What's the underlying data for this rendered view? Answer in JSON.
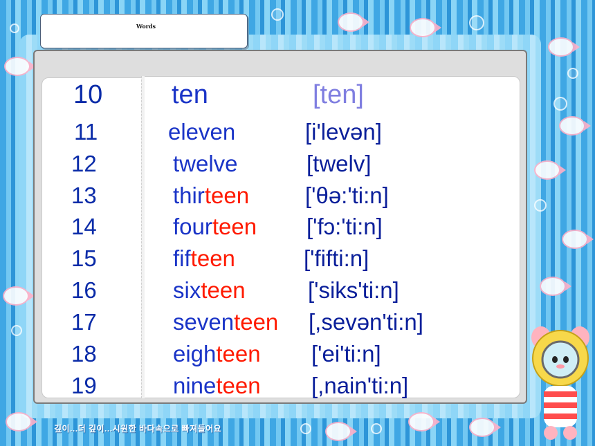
{
  "slide": {
    "title": "Words",
    "caption": "깊이...더 깊이...시원한 바다속으로 빠져들어요",
    "numbers": [
      {
        "number": "10",
        "word_prefix": "",
        "word_stem": "ten",
        "word_suffix": "",
        "phonetic": "[ten]"
      },
      {
        "number": "11",
        "word_prefix": "eleven",
        "word_stem": "",
        "word_suffix": "",
        "phonetic": "[i'levən]"
      },
      {
        "number": "12",
        "word_prefix": "twelve",
        "word_stem": "",
        "word_suffix": "",
        "phonetic": "[twelv]"
      },
      {
        "number": "13",
        "word_prefix": "thir",
        "word_stem": "teen",
        "word_suffix": "",
        "phonetic": "['θə:'ti:n]"
      },
      {
        "number": "14",
        "word_prefix": "four",
        "word_stem": "teen",
        "word_suffix": "",
        "phonetic": "['fɔ:'ti:n]"
      },
      {
        "number": "15",
        "word_prefix": "fif",
        "word_stem": "teen",
        "word_suffix": "",
        "phonetic": "['fifti:n]"
      },
      {
        "number": "16",
        "word_prefix": "six",
        "word_stem": "teen",
        "word_suffix": "",
        "phonetic": "['siks'ti:n]"
      },
      {
        "number": "17",
        "word_prefix": "seven",
        "word_stem": "teen",
        "word_suffix": "",
        "phonetic": "[,sevən'ti:n]"
      },
      {
        "number": "18",
        "word_prefix": "eigh",
        "word_stem": "teen",
        "word_suffix": "",
        "phonetic": "['ei'ti:n]"
      },
      {
        "number": "19",
        "word_prefix": "nine",
        "word_stem": "teen",
        "word_suffix": "",
        "phonetic": "[,nain'ti:n]"
      }
    ]
  },
  "colors": {
    "number": "#0a2ba8",
    "word": "#1a34c7",
    "teen_suffix": "#ff1a00",
    "phonetic": "#0a1f9a",
    "phonetic_first": "#7f7ee0"
  }
}
